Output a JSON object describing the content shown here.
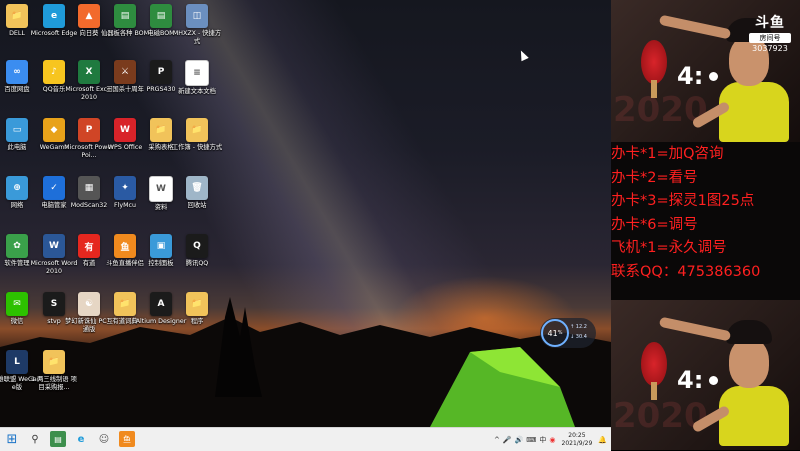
{
  "desktop": {
    "icons": [
      {
        "label": "DELL",
        "color": "#f1c35a",
        "glyph": "📁"
      },
      {
        "label": "Microsoft Edge",
        "color": "#1f9bd9",
        "glyph": "e"
      },
      {
        "label": "向日葵",
        "color": "#f26a2c",
        "glyph": "▲"
      },
      {
        "label": "仙器板各种 BOM",
        "color": "#2e8c3f",
        "glyph": "▤"
      },
      {
        "label": "电磁BOM",
        "color": "#2e8c3f",
        "glyph": "▤"
      },
      {
        "label": "MHXZX - 快捷方式",
        "color": "#6b8fbf",
        "glyph": "◫"
      },
      {
        "label": "百度网盘",
        "color": "#3b8df0",
        "glyph": "∞"
      },
      {
        "label": "QQ音乐",
        "color": "#f7c51f",
        "glyph": "♪"
      },
      {
        "label": "Microsoft Excel 2010",
        "color": "#1f7a3f",
        "glyph": "X"
      },
      {
        "label": "三国杀十周年",
        "color": "#7a3b1d",
        "glyph": "⚔"
      },
      {
        "label": "PRGS430",
        "color": "#1b1b1b",
        "glyph": "P"
      },
      {
        "label": "新建文本文档",
        "color": "#ffffff",
        "glyph": "≡"
      },
      {
        "label": "此电脑",
        "color": "#3a9ad9",
        "glyph": "▭"
      },
      {
        "label": "WeGame",
        "color": "#e8a21a",
        "glyph": "◆"
      },
      {
        "label": "Microsoft PowerPoi...",
        "color": "#d04526",
        "glyph": "P"
      },
      {
        "label": "WPS Office",
        "color": "#d82329",
        "glyph": "W"
      },
      {
        "label": "采购表格",
        "color": "#f1c35a",
        "glyph": "📁"
      },
      {
        "label": "工作簿 - 快捷方式",
        "color": "#f1c35a",
        "glyph": "📁"
      },
      {
        "label": "网络",
        "color": "#3a9ad9",
        "glyph": "⊕"
      },
      {
        "label": "电脑管家",
        "color": "#1e6fd9",
        "glyph": "✓"
      },
      {
        "label": "ModScan32",
        "color": "#555555",
        "glyph": "▦"
      },
      {
        "label": "FlyMcu",
        "color": "#2a5aa3",
        "glyph": "✦"
      },
      {
        "label": "资料",
        "color": "#ffffff",
        "glyph": "W"
      },
      {
        "label": "回收站",
        "color": "#9fb6c8",
        "glyph": "🗑"
      },
      {
        "label": "软件管理",
        "color": "#3aa04a",
        "glyph": "✿"
      },
      {
        "label": "Microsoft Word 2010",
        "color": "#2b5797",
        "glyph": "W"
      },
      {
        "label": "有道",
        "color": "#e5271f",
        "glyph": "有"
      },
      {
        "label": "斗鱼直播伴侣",
        "color": "#f08a1e",
        "glyph": "鱼"
      },
      {
        "label": "控制面板",
        "color": "#3a9ad9",
        "glyph": "▣"
      },
      {
        "label": "腾讯QQ",
        "color": "#1b1b1b",
        "glyph": "Q"
      },
      {
        "label": "微信",
        "color": "#2dc100",
        "glyph": "✉"
      },
      {
        "label": "stvp",
        "color": "#1b1b1b",
        "glyph": "S"
      },
      {
        "label": "梦幻新诛仙 PC互通版",
        "color": "#e6d6c4",
        "glyph": "☯"
      },
      {
        "label": "有道词典",
        "color": "#f1c35a",
        "glyph": "📁"
      },
      {
        "label": "Altium Designer",
        "color": "#1b1b1b",
        "glyph": "A"
      },
      {
        "label": "程序",
        "color": "#f1c35a",
        "glyph": "📁"
      },
      {
        "label": "英雄联盟 WeGame版",
        "color": "#1e3a66",
        "glyph": "L"
      },
      {
        "label": "1 两三线制语 项目采购报...",
        "color": "#f1c35a",
        "glyph": "📁"
      }
    ]
  },
  "widget": {
    "percent": "41",
    "unit": "%",
    "up": "12.2",
    "down": "30.4"
  },
  "taskbar": {
    "start_icon": "⊞",
    "search_icon": "⚲",
    "time": "20:25",
    "date": "2021/9/29",
    "tray": [
      "^",
      "🎤",
      "🔊",
      "⌨",
      "中",
      "🔔"
    ]
  },
  "overlay": {
    "logo_top": "斗鱼",
    "logo_sub": "房间号",
    "room_number": "3037923",
    "score": "4:",
    "watermark_year": "2020",
    "ad_lines": [
      "办卡*1=加Q咨询",
      "办卡*2=看号",
      "办卡*3=探灵1图25点",
      "办卡*6=调号",
      "飞机*1=永久调号",
      "联系QQ：475386360"
    ],
    "ad_color": "#ff2020"
  }
}
